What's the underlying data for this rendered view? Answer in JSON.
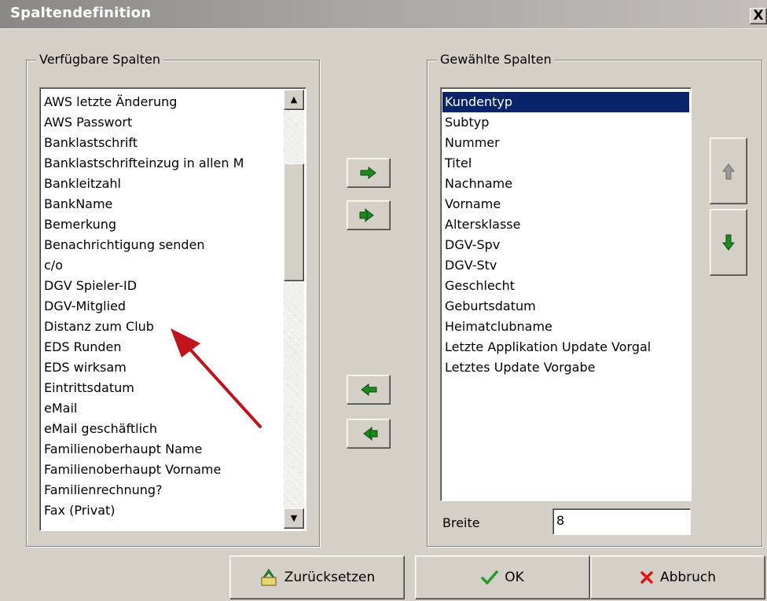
{
  "window": {
    "title": "Spaltendefinition",
    "close_label": "X"
  },
  "available": {
    "label": "Verfügbare Spalten",
    "items": [
      "AWS letzte Änderung",
      "AWS Passwort",
      "Banklastschrift",
      "Banklastschrifteinzug in allen M",
      "Bankleitzahl",
      "BankName",
      "Bemerkung",
      "Benachrichtigung senden",
      "c/o",
      "DGV Spieler-ID",
      "DGV-Mitglied",
      "Distanz zum Club",
      "EDS Runden",
      "EDS wirksam",
      "Eintrittsdatum",
      "eMail",
      "eMail geschäftlich",
      "Familienoberhaupt Name",
      "Familienoberhaupt Vorname",
      "Familienrechnung?",
      "Fax (Privat)"
    ]
  },
  "selected": {
    "label": "Gewählte Spalten",
    "items": [
      "Kundentyp",
      "Subtyp",
      "Nummer",
      "Titel",
      "Nachname",
      "Vorname",
      "Altersklasse",
      "DGV-Spv",
      "DGV-Stv",
      "Geschlecht",
      "Geburtsdatum",
      "Heimatclubname",
      "Letzte Applikation Update Vorgal",
      "Letztes Update Vorgabe"
    ],
    "active_item": "Kundentyp"
  },
  "width_field": {
    "label": "Breite",
    "value": "8"
  },
  "buttons": {
    "reset_label": "Zurücksetzen",
    "ok_label": "OK",
    "cancel_label": "Abbruch"
  },
  "icons": {
    "move_right": "arrow-right-icon",
    "move_all_right": "double-arrow-right-icon",
    "move_left": "arrow-left-icon",
    "move_all_left": "double-arrow-left-icon",
    "move_up": "arrow-up-icon",
    "move_down": "arrow-down-icon",
    "annotation": "red-arrow-annotation"
  },
  "colors": {
    "dialog_bg": "#d4d0c8",
    "selection": "#0a246a",
    "arrow_green": "#1d8a1d",
    "annotation_red": "#c0141c"
  }
}
